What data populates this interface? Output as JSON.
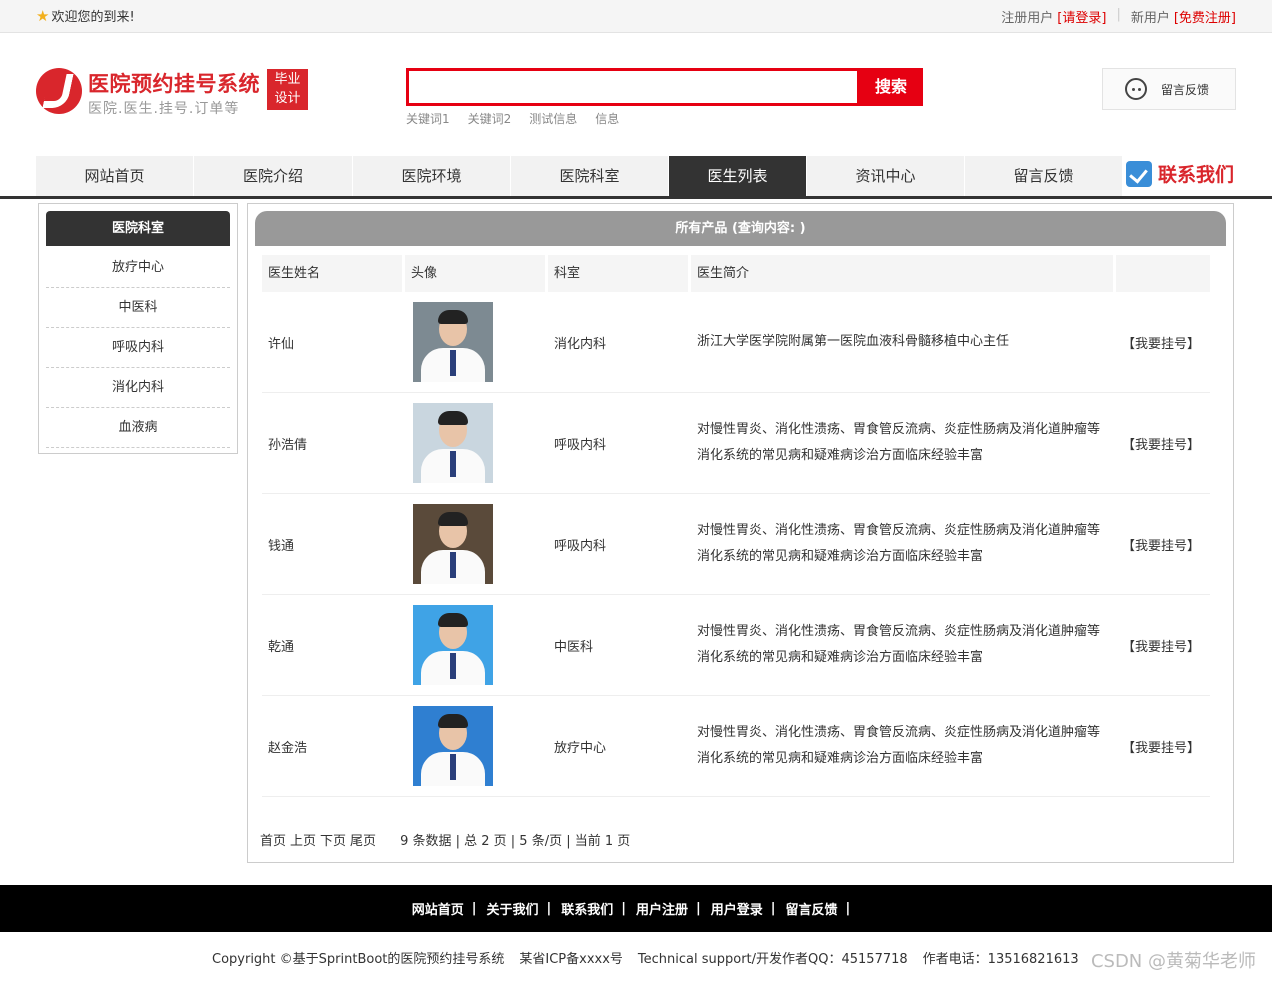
{
  "topbar": {
    "welcome": "欢迎您的到来!",
    "registered_label": "注册用户",
    "login_link": "[请登录]",
    "new_label": "新用户",
    "register_link": "[免费注册]"
  },
  "logo": {
    "title": "医院预约挂号系统",
    "subtitle": "医院.医生.挂号.订单等",
    "badge_line1": "毕业",
    "badge_line2": "设计"
  },
  "search": {
    "value": "",
    "button": "搜索",
    "keywords": [
      "关键词1",
      "关键词2",
      "测试信息",
      "信息"
    ]
  },
  "feedback": "留言反馈",
  "nav": {
    "items": [
      "网站首页",
      "医院介绍",
      "医院环境",
      "医院科室",
      "医生列表",
      "资讯中心",
      "留言反馈"
    ],
    "active_index": 4,
    "contact": "联系我们"
  },
  "sidebar": {
    "title": "医院科室",
    "items": [
      "放疗中心",
      "中医科",
      "呼吸内科",
      "消化内科",
      "血液病"
    ]
  },
  "main": {
    "bar_title": "所有产品 (查询内容: )",
    "columns": [
      "医生姓名",
      "头像",
      "科室",
      "医生简介",
      ""
    ],
    "rows": [
      {
        "name": "许仙",
        "dept": "消化内科",
        "desc1": "浙江大学医学院附属第一医院血液科骨髓移植中心主任",
        "desc2": "",
        "action": "【我要挂号】"
      },
      {
        "name": "孙浩倩",
        "dept": "呼吸内科",
        "desc1": "对慢性胃炎、消化性溃疡、胃食管反流病、炎症性肠病及消化道肿瘤等",
        "desc2": "消化系统的常见病和疑难病诊治方面临床经验丰富",
        "action": "【我要挂号】"
      },
      {
        "name": "钱通",
        "dept": "呼吸内科",
        "desc1": "对慢性胃炎、消化性溃疡、胃食管反流病、炎症性肠病及消化道肿瘤等",
        "desc2": "消化系统的常见病和疑难病诊治方面临床经验丰富",
        "action": "【我要挂号】"
      },
      {
        "name": "乾通",
        "dept": "中医科",
        "desc1": "对慢性胃炎、消化性溃疡、胃食管反流病、炎症性肠病及消化道肿瘤等",
        "desc2": "消化系统的常见病和疑难病诊治方面临床经验丰富",
        "action": "【我要挂号】"
      },
      {
        "name": "赵金浩",
        "dept": "放疗中心",
        "desc1": "对慢性胃炎、消化性溃疡、胃食管反流病、炎症性肠病及消化道肿瘤等",
        "desc2": "消化系统的常见病和疑难病诊治方面临床经验丰富",
        "action": "【我要挂号】"
      }
    ],
    "photo_backgrounds": [
      "#7d8a92",
      "#c9d6df",
      "#5a4a3a",
      "#3fa3e6",
      "#2f7fd1"
    ],
    "pager": {
      "first": "首页",
      "prev": "上页",
      "next": "下页",
      "last": "尾页",
      "info": "9 条数据 | 总 2 页 | 5 条/页 | 当前 1 页"
    }
  },
  "footer": {
    "links": [
      "网站首页",
      "关于我们",
      "联系我们",
      "用户注册",
      "用户登录",
      "留言反馈"
    ],
    "copyright": "Copyright ©基于SprintBoot的医院预约挂号系统",
    "icp": "某省ICP备xxxx号",
    "support": "Technical support/开发作者QQ：45157718",
    "phone": "作者电话：13516821613"
  },
  "watermark": "CSDN @黄菊华老师"
}
